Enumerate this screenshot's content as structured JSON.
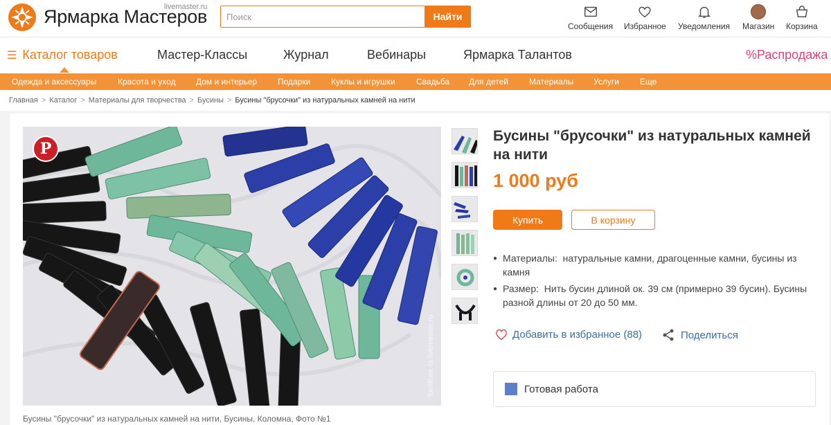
{
  "header": {
    "logo_text": "Ярмарка Мастеров",
    "logo_domain": "livemaster.ru",
    "search_placeholder": "Поиск",
    "search_button": "Найти",
    "nav": [
      {
        "label": "Сообщения",
        "icon": "envelope-icon"
      },
      {
        "label": "Избранное",
        "icon": "heart-icon"
      },
      {
        "label": "Уведомления",
        "icon": "bell-icon"
      },
      {
        "label": "Магазин",
        "icon": "avatar"
      },
      {
        "label": "Корзина",
        "icon": "basket-icon"
      }
    ]
  },
  "mainnav": {
    "catalog": "Каталог товаров",
    "items": [
      "Мастер-Классы",
      "Журнал",
      "Вебинары",
      "Ярмарка Талантов"
    ],
    "sale": "%Распродажа"
  },
  "categories": [
    "Одежда и аксессуары",
    "Красота и уход",
    "Дом и интерьер",
    "Подарки",
    "Куклы и игрушки",
    "Свадьба",
    "Для детей",
    "Материалы",
    "Услуги",
    "Еще"
  ],
  "breadcrumb": [
    "Главная",
    "Каталог",
    "Материалы для творчества",
    "Бусины",
    "Бусины \"брусочки\" из натуральных камней на нити"
  ],
  "product": {
    "title": "Бусины \"брусочки\" из натуральных камней на нити",
    "price": "1 000 руб",
    "buy_label": "Купить",
    "cart_label": "В корзину",
    "materials_label": "Материалы:",
    "materials_value": "натуральные камни, драгоценные камни, бусины из камня",
    "size_label": "Размер:",
    "size_value": "Нить бусин длиной ок. 39 см (примерно 39 бусин). Бусины разной длины от 20 до 50 мм.",
    "favorite_label": "Добавить в избранное (88)",
    "share_label": "Поделиться",
    "status_label": "Готовая работа",
    "photo_caption": "Бусины \"брусочки\" из натуральных камней на нити, Бусины, Коломна, Фото №1",
    "watermark": "furnitura-la.livemaster.ru",
    "pinterest_glyph": "P"
  },
  "colors": {
    "accent": "#f07a18",
    "category_bar": "#f39237",
    "link": "#3a6ea5",
    "sale": "#e0407b"
  }
}
